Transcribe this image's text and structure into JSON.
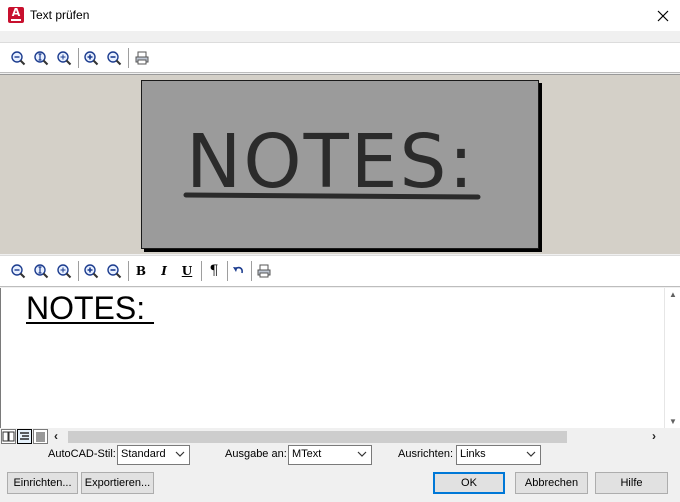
{
  "window": {
    "title": "Text prüfen",
    "app_icon_letter": "A"
  },
  "preview": {
    "image_text": "NOTES:"
  },
  "toolbar_top": {
    "icons": [
      "zoom-out-icon",
      "zoom-fit-icon",
      "zoom-window-icon",
      "zoom-in-icon",
      "zoom-out-2-icon",
      "print-icon"
    ]
  },
  "toolbar_bottom": {
    "icons": [
      "zoom-out-icon",
      "zoom-fit-icon",
      "zoom-window-icon",
      "zoom-in-icon",
      "zoom-out-2-icon"
    ],
    "bold": "B",
    "italic": "I",
    "underline": "U",
    "paragraph": "¶",
    "undo_icon": "undo-icon",
    "print_icon": "print-icon"
  },
  "editor": {
    "text": "NOTES: "
  },
  "options": {
    "style_label": "AutoCAD-Stil:",
    "style_value": "Standard",
    "output_label": "Ausgabe an:",
    "output_value": "MText",
    "align_label": "Ausrichten:",
    "align_value": "Links"
  },
  "buttons": {
    "setup": "Einrichten...",
    "export": "Exportieren...",
    "ok": "OK",
    "cancel": "Abbrechen",
    "help": "Hilfe"
  },
  "colors": {
    "accent": "#0078d7",
    "app_icon": "#c8102e",
    "preview_bg": "#d4d0c8",
    "image_bg": "#9b9b9b"
  }
}
